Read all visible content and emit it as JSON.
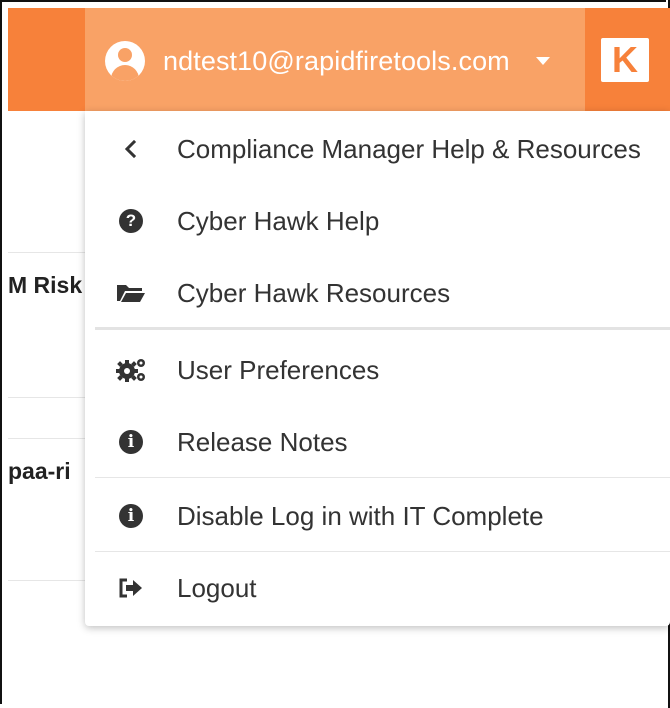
{
  "header": {
    "user_email": "ndtest10@rapidfiretools.com",
    "logo_text": "K",
    "user_icon": "user-circle-icon",
    "dropdown_icon": "caret-down-icon"
  },
  "background": {
    "row1_text": "M Risk",
    "row2_text": "paa-ri"
  },
  "menu": {
    "items": [
      {
        "label": "Compliance Manager Help & Resources",
        "icon": "chevron-left-icon"
      },
      {
        "label": "Cyber Hawk Help",
        "icon": "question-circle-icon"
      },
      {
        "label": "Cyber Hawk Resources",
        "icon": "folder-open-icon"
      },
      {
        "label": "User Preferences",
        "icon": "gears-icon"
      },
      {
        "label": "Release Notes",
        "icon": "info-circle-icon"
      },
      {
        "label": "Disable Log in with IT Complete",
        "icon": "info-circle-icon",
        "highlighted": true
      },
      {
        "label": "Logout",
        "icon": "sign-out-icon"
      }
    ]
  },
  "colors": {
    "header_bg": "#f7813a",
    "user_tab_bg": "#f9a266",
    "highlight": "#fbf65a"
  }
}
